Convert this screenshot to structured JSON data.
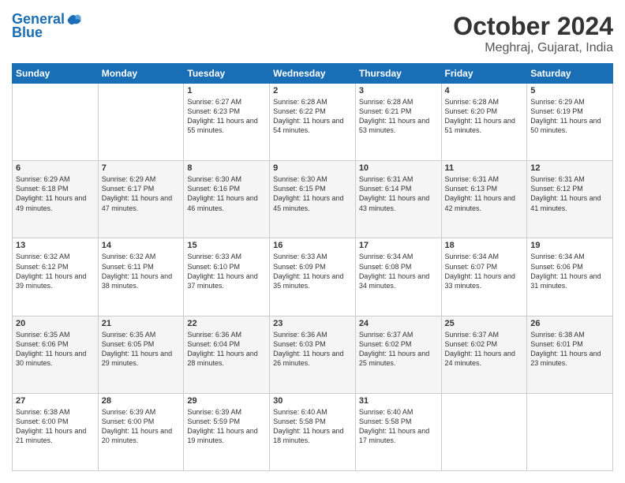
{
  "header": {
    "logo_line1": "General",
    "logo_line2": "Blue",
    "title": "October 2024",
    "subtitle": "Meghraj, Gujarat, India"
  },
  "weekdays": [
    "Sunday",
    "Monday",
    "Tuesday",
    "Wednesday",
    "Thursday",
    "Friday",
    "Saturday"
  ],
  "weeks": [
    [
      {
        "day": "",
        "sunrise": "",
        "sunset": "",
        "daylight": ""
      },
      {
        "day": "",
        "sunrise": "",
        "sunset": "",
        "daylight": ""
      },
      {
        "day": "1",
        "sunrise": "Sunrise: 6:27 AM",
        "sunset": "Sunset: 6:23 PM",
        "daylight": "Daylight: 11 hours and 55 minutes."
      },
      {
        "day": "2",
        "sunrise": "Sunrise: 6:28 AM",
        "sunset": "Sunset: 6:22 PM",
        "daylight": "Daylight: 11 hours and 54 minutes."
      },
      {
        "day": "3",
        "sunrise": "Sunrise: 6:28 AM",
        "sunset": "Sunset: 6:21 PM",
        "daylight": "Daylight: 11 hours and 53 minutes."
      },
      {
        "day": "4",
        "sunrise": "Sunrise: 6:28 AM",
        "sunset": "Sunset: 6:20 PM",
        "daylight": "Daylight: 11 hours and 51 minutes."
      },
      {
        "day": "5",
        "sunrise": "Sunrise: 6:29 AM",
        "sunset": "Sunset: 6:19 PM",
        "daylight": "Daylight: 11 hours and 50 minutes."
      }
    ],
    [
      {
        "day": "6",
        "sunrise": "Sunrise: 6:29 AM",
        "sunset": "Sunset: 6:18 PM",
        "daylight": "Daylight: 11 hours and 49 minutes."
      },
      {
        "day": "7",
        "sunrise": "Sunrise: 6:29 AM",
        "sunset": "Sunset: 6:17 PM",
        "daylight": "Daylight: 11 hours and 47 minutes."
      },
      {
        "day": "8",
        "sunrise": "Sunrise: 6:30 AM",
        "sunset": "Sunset: 6:16 PM",
        "daylight": "Daylight: 11 hours and 46 minutes."
      },
      {
        "day": "9",
        "sunrise": "Sunrise: 6:30 AM",
        "sunset": "Sunset: 6:15 PM",
        "daylight": "Daylight: 11 hours and 45 minutes."
      },
      {
        "day": "10",
        "sunrise": "Sunrise: 6:31 AM",
        "sunset": "Sunset: 6:14 PM",
        "daylight": "Daylight: 11 hours and 43 minutes."
      },
      {
        "day": "11",
        "sunrise": "Sunrise: 6:31 AM",
        "sunset": "Sunset: 6:13 PM",
        "daylight": "Daylight: 11 hours and 42 minutes."
      },
      {
        "day": "12",
        "sunrise": "Sunrise: 6:31 AM",
        "sunset": "Sunset: 6:12 PM",
        "daylight": "Daylight: 11 hours and 41 minutes."
      }
    ],
    [
      {
        "day": "13",
        "sunrise": "Sunrise: 6:32 AM",
        "sunset": "Sunset: 6:12 PM",
        "daylight": "Daylight: 11 hours and 39 minutes."
      },
      {
        "day": "14",
        "sunrise": "Sunrise: 6:32 AM",
        "sunset": "Sunset: 6:11 PM",
        "daylight": "Daylight: 11 hours and 38 minutes."
      },
      {
        "day": "15",
        "sunrise": "Sunrise: 6:33 AM",
        "sunset": "Sunset: 6:10 PM",
        "daylight": "Daylight: 11 hours and 37 minutes."
      },
      {
        "day": "16",
        "sunrise": "Sunrise: 6:33 AM",
        "sunset": "Sunset: 6:09 PM",
        "daylight": "Daylight: 11 hours and 35 minutes."
      },
      {
        "day": "17",
        "sunrise": "Sunrise: 6:34 AM",
        "sunset": "Sunset: 6:08 PM",
        "daylight": "Daylight: 11 hours and 34 minutes."
      },
      {
        "day": "18",
        "sunrise": "Sunrise: 6:34 AM",
        "sunset": "Sunset: 6:07 PM",
        "daylight": "Daylight: 11 hours and 33 minutes."
      },
      {
        "day": "19",
        "sunrise": "Sunrise: 6:34 AM",
        "sunset": "Sunset: 6:06 PM",
        "daylight": "Daylight: 11 hours and 31 minutes."
      }
    ],
    [
      {
        "day": "20",
        "sunrise": "Sunrise: 6:35 AM",
        "sunset": "Sunset: 6:06 PM",
        "daylight": "Daylight: 11 hours and 30 minutes."
      },
      {
        "day": "21",
        "sunrise": "Sunrise: 6:35 AM",
        "sunset": "Sunset: 6:05 PM",
        "daylight": "Daylight: 11 hours and 29 minutes."
      },
      {
        "day": "22",
        "sunrise": "Sunrise: 6:36 AM",
        "sunset": "Sunset: 6:04 PM",
        "daylight": "Daylight: 11 hours and 28 minutes."
      },
      {
        "day": "23",
        "sunrise": "Sunrise: 6:36 AM",
        "sunset": "Sunset: 6:03 PM",
        "daylight": "Daylight: 11 hours and 26 minutes."
      },
      {
        "day": "24",
        "sunrise": "Sunrise: 6:37 AM",
        "sunset": "Sunset: 6:02 PM",
        "daylight": "Daylight: 11 hours and 25 minutes."
      },
      {
        "day": "25",
        "sunrise": "Sunrise: 6:37 AM",
        "sunset": "Sunset: 6:02 PM",
        "daylight": "Daylight: 11 hours and 24 minutes."
      },
      {
        "day": "26",
        "sunrise": "Sunrise: 6:38 AM",
        "sunset": "Sunset: 6:01 PM",
        "daylight": "Daylight: 11 hours and 23 minutes."
      }
    ],
    [
      {
        "day": "27",
        "sunrise": "Sunrise: 6:38 AM",
        "sunset": "Sunset: 6:00 PM",
        "daylight": "Daylight: 11 hours and 21 minutes."
      },
      {
        "day": "28",
        "sunrise": "Sunrise: 6:39 AM",
        "sunset": "Sunset: 6:00 PM",
        "daylight": "Daylight: 11 hours and 20 minutes."
      },
      {
        "day": "29",
        "sunrise": "Sunrise: 6:39 AM",
        "sunset": "Sunset: 5:59 PM",
        "daylight": "Daylight: 11 hours and 19 minutes."
      },
      {
        "day": "30",
        "sunrise": "Sunrise: 6:40 AM",
        "sunset": "Sunset: 5:58 PM",
        "daylight": "Daylight: 11 hours and 18 minutes."
      },
      {
        "day": "31",
        "sunrise": "Sunrise: 6:40 AM",
        "sunset": "Sunset: 5:58 PM",
        "daylight": "Daylight: 11 hours and 17 minutes."
      },
      {
        "day": "",
        "sunrise": "",
        "sunset": "",
        "daylight": ""
      },
      {
        "day": "",
        "sunrise": "",
        "sunset": "",
        "daylight": ""
      }
    ]
  ]
}
